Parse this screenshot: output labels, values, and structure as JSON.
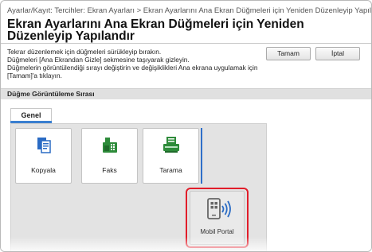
{
  "breadcrumb": "Ayarlar/Kayıt: Tercihler: Ekran Ayarları > Ekran Ayarlarını Ana Ekran Düğmeleri için Yeniden Düzenleyip Yapılandır",
  "page_title": "Ekran Ayarlarını Ana Ekran Düğmeleri için Yeniden Düzenleyip Yapılandır",
  "instructions": {
    "line1": "Tekrar düzenlemek için düğmeleri sürükleyip bırakın.",
    "line2": "Düğmeleri [Ana Ekrandan Gizle] sekmesine taşıyarak gizleyin.",
    "line3": "Düğmelerin görüntülendiği sırayı değiştirin ve değişiklikleri Ana ekrana uygulamak için [Tamam]'a tıklayın."
  },
  "buttons": {
    "ok": "Tamam",
    "cancel": "İptal"
  },
  "section_title": "Düğme Görüntüleme Sırası",
  "tabs": [
    {
      "label": "Genel"
    }
  ],
  "tiles": [
    {
      "label": "Kopyala",
      "icon": "copy-icon"
    },
    {
      "label": "Faks",
      "icon": "fax-icon"
    },
    {
      "label": "Tarama",
      "icon": "scan-icon"
    }
  ],
  "dragged_tile": {
    "label": "Mobil Portal",
    "icon": "mobile-portal-icon"
  },
  "colors": {
    "accent_blue": "#2f6fc9",
    "highlight_red": "#e11d2a",
    "icon_blue": "#2a6bc4",
    "icon_green": "#2e8b3a"
  }
}
